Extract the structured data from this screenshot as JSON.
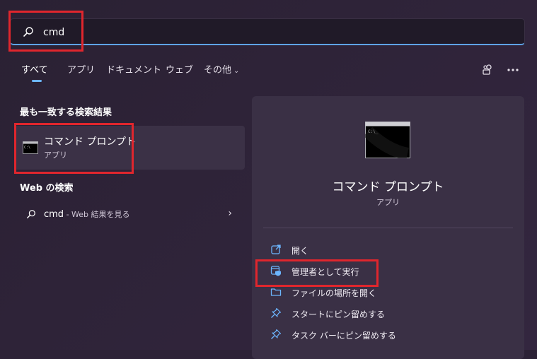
{
  "search": {
    "value": "cmd"
  },
  "tabs": [
    {
      "label": "すべて"
    },
    {
      "label": "アプリ"
    },
    {
      "label": "ドキュメント"
    },
    {
      "label": "ウェブ"
    },
    {
      "label": "その他"
    }
  ],
  "best_match": {
    "heading": "最も一致する検索結果",
    "name": "コマンド プロンプト",
    "kind": "アプリ"
  },
  "web_search": {
    "heading": "Web の検索",
    "query": "cmd",
    "suffix": " - Web 結果を見る"
  },
  "detail": {
    "title": "コマンド プロンプト",
    "subtitle": "アプリ",
    "actions": [
      {
        "label": "開く",
        "icon": "open-icon"
      },
      {
        "label": "管理者として実行",
        "icon": "run-as-admin-icon"
      },
      {
        "label": "ファイルの場所を開く",
        "icon": "folder-icon"
      },
      {
        "label": "スタートにピン留めする",
        "icon": "pin-icon"
      },
      {
        "label": "タスク バーにピン留めする",
        "icon": "pin-icon"
      }
    ]
  },
  "colors": {
    "accent": "#6cb6ff",
    "highlight_box": "#e0262d",
    "background": "#2c2236"
  }
}
